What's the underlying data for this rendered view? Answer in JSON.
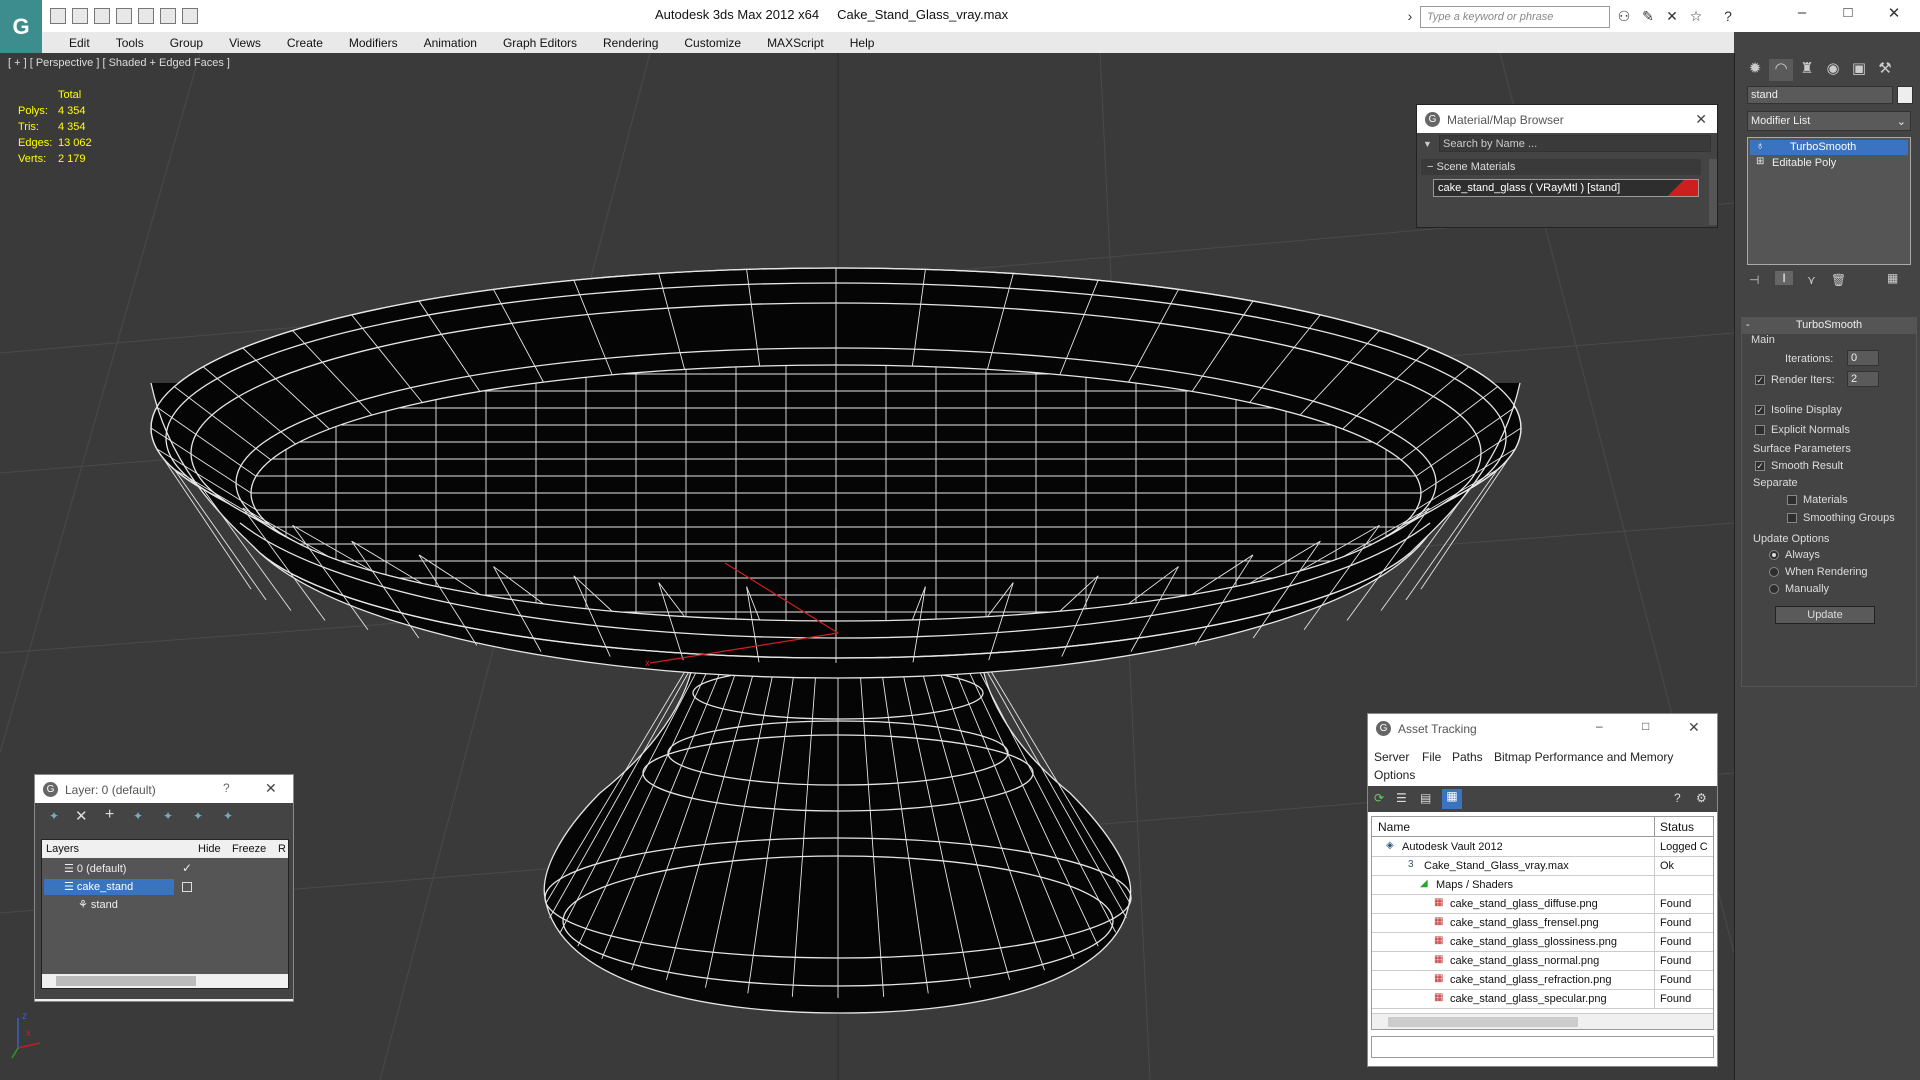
{
  "app": {
    "title": "Autodesk 3ds Max  2012 x64",
    "file": "Cake_Stand_Glass_vray.max",
    "search_placeholder": "Type a keyword or phrase"
  },
  "menus": [
    "Edit",
    "Tools",
    "Group",
    "Views",
    "Create",
    "Modifiers",
    "Animation",
    "Graph Editors",
    "Rendering",
    "Customize",
    "MAXScript",
    "Help"
  ],
  "viewport": {
    "label": "[ + ] [ Perspective ] [ Shaded + Edged Faces ]",
    "stats_header": "Total",
    "stats": [
      {
        "label": "Polys:",
        "value": "4 354"
      },
      {
        "label": "Tris:",
        "value": "4 354"
      },
      {
        "label": "Edges:",
        "value": "13 062"
      },
      {
        "label": "Verts:",
        "value": "2 179"
      }
    ],
    "axis_labels": {
      "x": "x",
      "y": "y",
      "z": "z"
    }
  },
  "material_browser": {
    "title": "Material/Map Browser",
    "search_placeholder": "Search by Name ...",
    "section": "Scene Materials",
    "item": "cake_stand_glass  ( VRayMtl ) [stand]",
    "accent": "#cc2020"
  },
  "command_panel": {
    "object_name": "stand",
    "modifier_list": "Modifier List",
    "stack": [
      "TurboSmooth",
      "Editable Poly"
    ],
    "rollout_title": "TurboSmooth",
    "main_label": "Main",
    "iterations_label": "Iterations:",
    "iterations_value": "0",
    "render_iters_label": "Render Iters:",
    "render_iters_value": "2",
    "isoline": "Isoline Display",
    "explicit_normals": "Explicit Normals",
    "surface_params": "Surface Parameters",
    "smooth_result": "Smooth Result",
    "separate": "Separate",
    "materials": "Materials",
    "smoothing_groups": "Smoothing Groups",
    "update_options": "Update Options",
    "always": "Always",
    "when_rendering": "When Rendering",
    "manually": "Manually",
    "update_btn": "Update"
  },
  "layer_manager": {
    "title": "Layer: 0 (default)",
    "help": "?",
    "columns": [
      "Layers",
      "Hide",
      "Freeze",
      "R"
    ],
    "rows": [
      "0 (default)",
      "cake_stand",
      "stand"
    ]
  },
  "asset_tracking": {
    "title": "Asset Tracking",
    "menus": [
      "Server",
      "File",
      "Paths",
      "Bitmap Performance and Memory",
      "Options"
    ],
    "columns": [
      "Name",
      "Status"
    ],
    "rows": [
      {
        "name": "Autodesk Vault 2012",
        "status": "Logged C"
      },
      {
        "name": "Cake_Stand_Glass_vray.max",
        "status": "Ok"
      },
      {
        "name": "Maps / Shaders",
        "status": ""
      },
      {
        "name": "cake_stand_glass_diffuse.png",
        "status": "Found"
      },
      {
        "name": "cake_stand_glass_frensel.png",
        "status": "Found"
      },
      {
        "name": "cake_stand_glass_glossiness.png",
        "status": "Found"
      },
      {
        "name": "cake_stand_glass_normal.png",
        "status": "Found"
      },
      {
        "name": "cake_stand_glass_refraction.png",
        "status": "Found"
      },
      {
        "name": "cake_stand_glass_specular.png",
        "status": "Found"
      }
    ]
  }
}
